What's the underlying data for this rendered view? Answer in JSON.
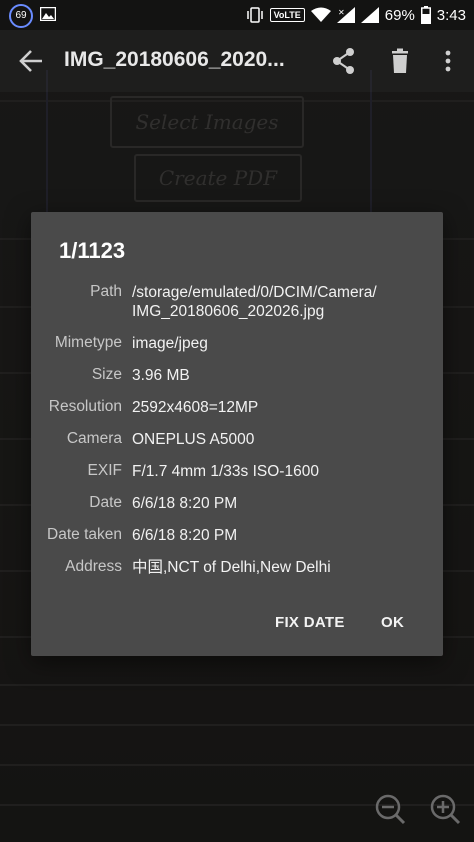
{
  "status_bar": {
    "notification_count": "69",
    "network_badge": "VoLTE",
    "battery": "69%",
    "time": "3:43"
  },
  "toolbar": {
    "title": "IMG_20180606_2020..."
  },
  "background_sketch": {
    "box1": "Select Images",
    "box2": "Create PDF"
  },
  "dialog": {
    "title": "1/1123",
    "rows": [
      {
        "label": "Path",
        "value": "/storage/emulated/0/DCIM/Camera/\nIMG_20180606_202026.jpg"
      },
      {
        "label": "Mimetype",
        "value": "image/jpeg"
      },
      {
        "label": "Size",
        "value": "3.96 MB"
      },
      {
        "label": "Resolution",
        "value": "2592x4608=12MP"
      },
      {
        "label": "Camera",
        "value": "ONEPLUS A5000"
      },
      {
        "label": "EXIF",
        "value": "F/1.7 4mm 1/33s ISO-1600"
      },
      {
        "label": "Date",
        "value": "6/6/18 8:20 PM"
      },
      {
        "label": "Date taken",
        "value": "6/6/18 8:20 PM"
      },
      {
        "label": "Address",
        "value": "中国,NCT of Delhi,New Delhi"
      }
    ],
    "buttons": {
      "fix_date": "FIX DATE",
      "ok": "OK"
    }
  }
}
